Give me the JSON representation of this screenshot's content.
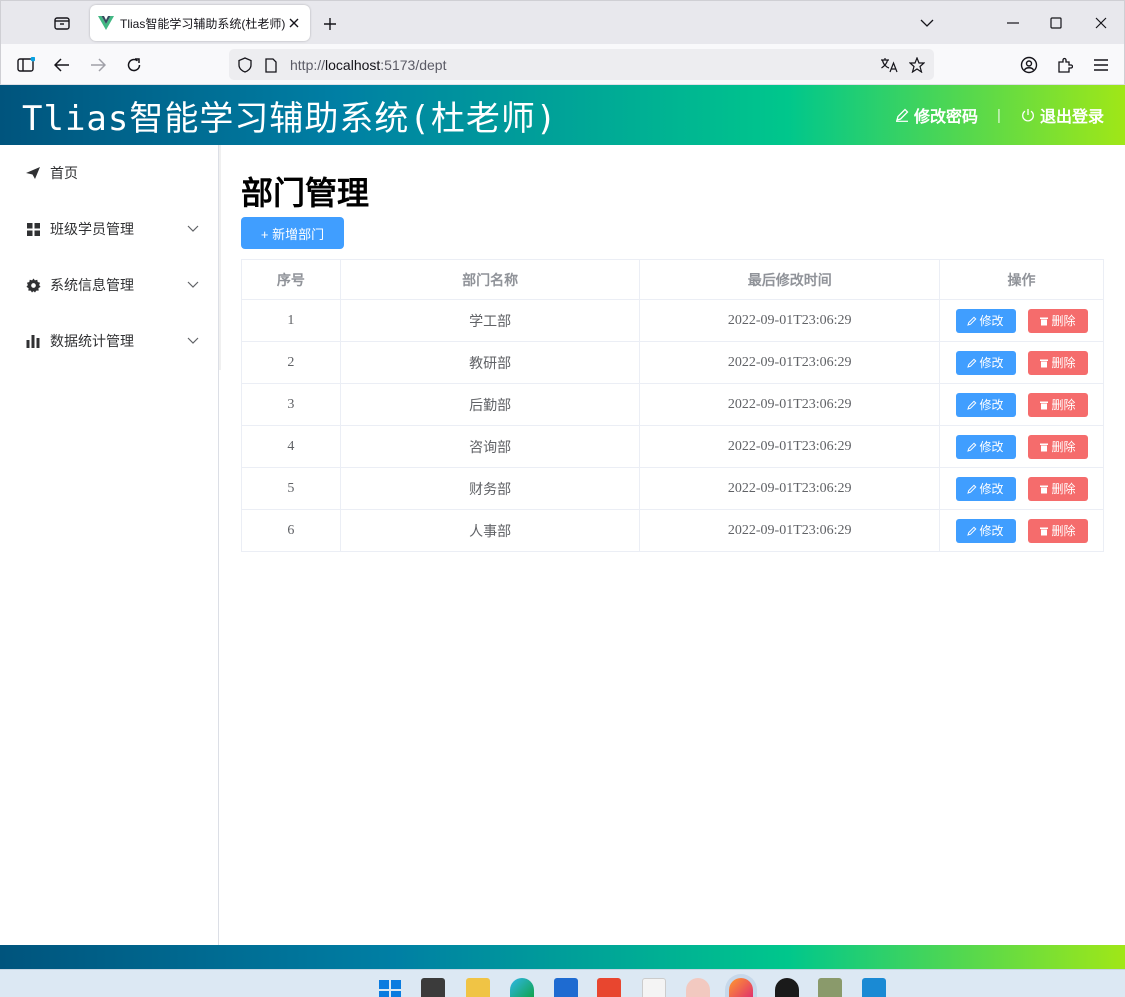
{
  "browser": {
    "tab_title": "Tlias智能学习辅助系统(杜老师)",
    "url_prefix": "http://",
    "url_host": "localhost",
    "url_rest": ":5173/dept"
  },
  "header": {
    "title": "Tlias智能学习辅助系统(杜老师)",
    "change_password": "修改密码",
    "separator": "|",
    "logout": "退出登录"
  },
  "sidebar": {
    "items": [
      {
        "label": "首页",
        "icon": "paper-plane-icon"
      },
      {
        "label": "班级学员管理",
        "icon": "grid-icon"
      },
      {
        "label": "系统信息管理",
        "icon": "gear-icon"
      },
      {
        "label": "数据统计管理",
        "icon": "bar-chart-icon"
      }
    ]
  },
  "main": {
    "title": "部门管理",
    "add_button": "+ 新增部门",
    "table": {
      "headers": [
        "序号",
        "部门名称",
        "最后修改时间",
        "操作"
      ],
      "rows": [
        {
          "idx": "1",
          "name": "学工部",
          "time": "2022-09-01T23:06:29"
        },
        {
          "idx": "2",
          "name": "教研部",
          "time": "2022-09-01T23:06:29"
        },
        {
          "idx": "3",
          "name": "后勤部",
          "time": "2022-09-01T23:06:29"
        },
        {
          "idx": "4",
          "name": "咨询部",
          "time": "2022-09-01T23:06:29"
        },
        {
          "idx": "5",
          "name": "财务部",
          "time": "2022-09-01T23:06:29"
        },
        {
          "idx": "6",
          "name": "人事部",
          "time": "2022-09-01T23:06:29"
        }
      ],
      "edit_label": "修改",
      "delete_label": "删除"
    }
  },
  "colors": {
    "primary": "#409eff",
    "danger": "#f56c6c",
    "header_gradient_start": "#00547d",
    "header_gradient_end": "#a0e717"
  }
}
